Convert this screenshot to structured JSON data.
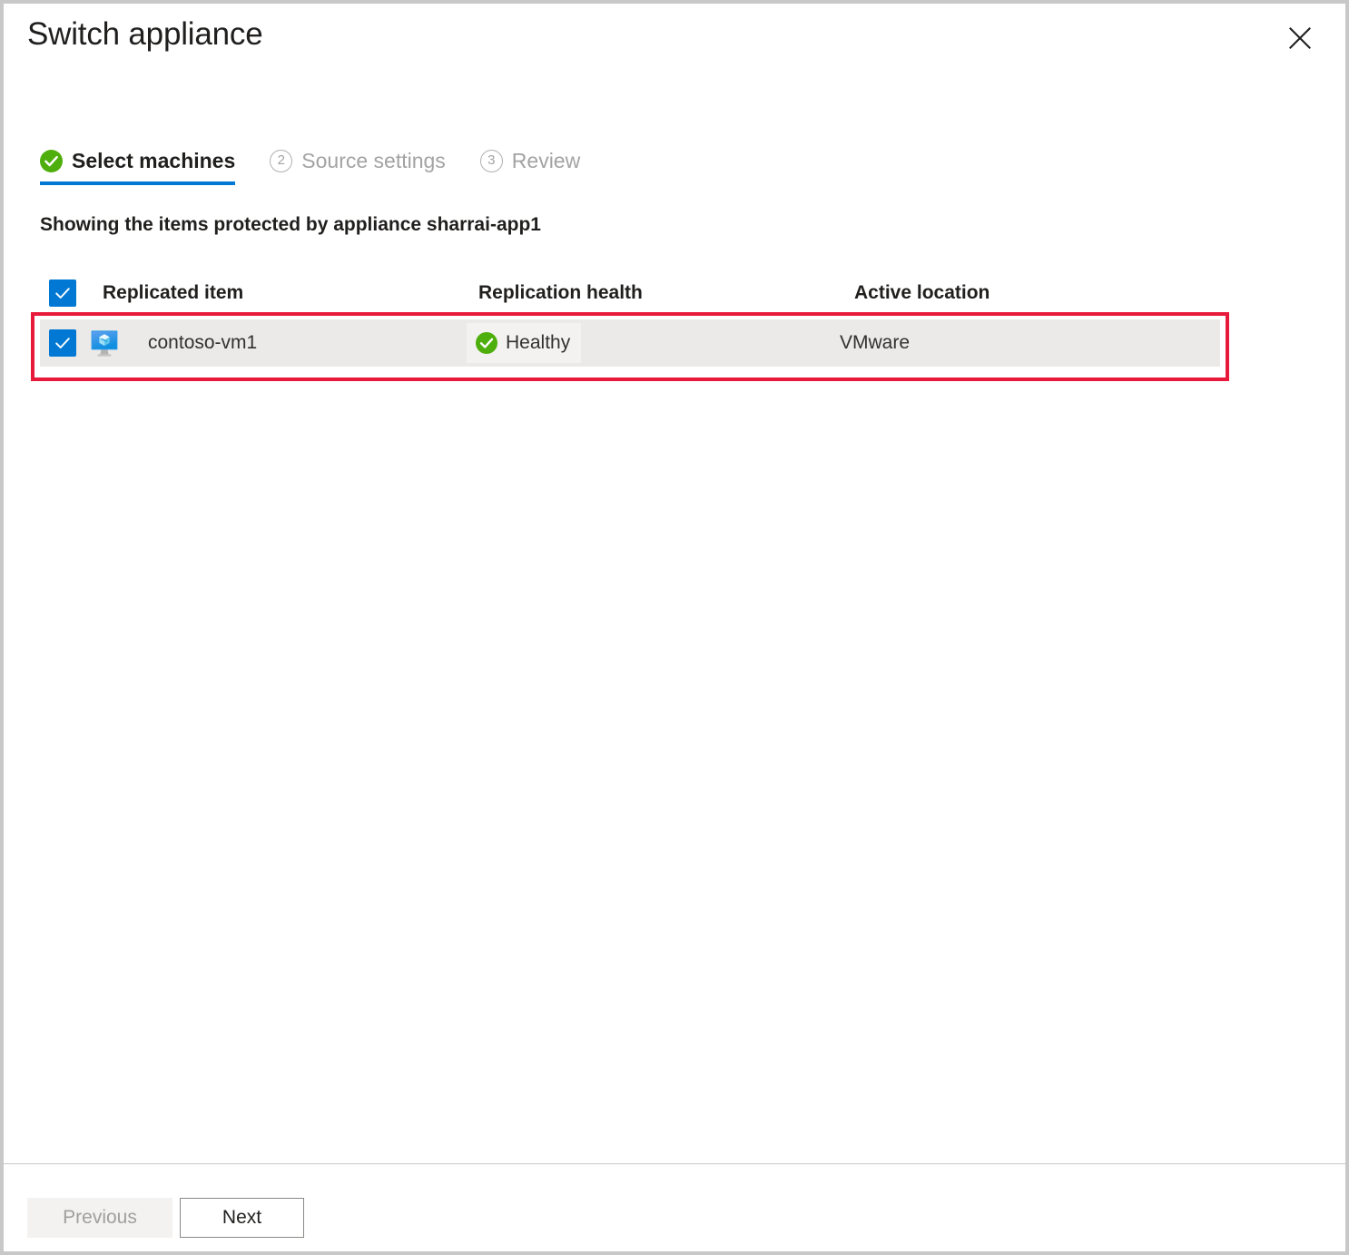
{
  "dialog": {
    "title": "Switch appliance",
    "close_icon": "close-icon",
    "close_label": "Close"
  },
  "steps": [
    {
      "id": "select-machines",
      "label": "Select machines",
      "state": "active",
      "badge": "check-circle-icon",
      "number": ""
    },
    {
      "id": "source-settings",
      "label": "Source settings",
      "state": "inactive",
      "badge": "number-badge",
      "number": "2"
    },
    {
      "id": "review",
      "label": "Review",
      "state": "inactive",
      "badge": "number-badge",
      "number": "3"
    }
  ],
  "subtitle": "Showing the items protected by appliance sharrai-app1",
  "table": {
    "select_all_checked": true,
    "headers": {
      "replicated_item": "Replicated item",
      "replication_health": "Replication health",
      "active_location": "Active location"
    },
    "rows": [
      {
        "checked": true,
        "icon": "virtual-machine-icon",
        "name": "contoso-vm1",
        "health": "Healthy",
        "health_icon": "healthy-check-icon",
        "location": "VMware"
      }
    ]
  },
  "footer": {
    "previous_label": "Previous",
    "next_label": "Next",
    "previous_disabled": true
  },
  "colors": {
    "accent": "#0078d4",
    "healthy": "#5db300",
    "annotation": "#e81a3b",
    "row_background": "#ebeae9",
    "frame_border": "#c8c8c8"
  }
}
